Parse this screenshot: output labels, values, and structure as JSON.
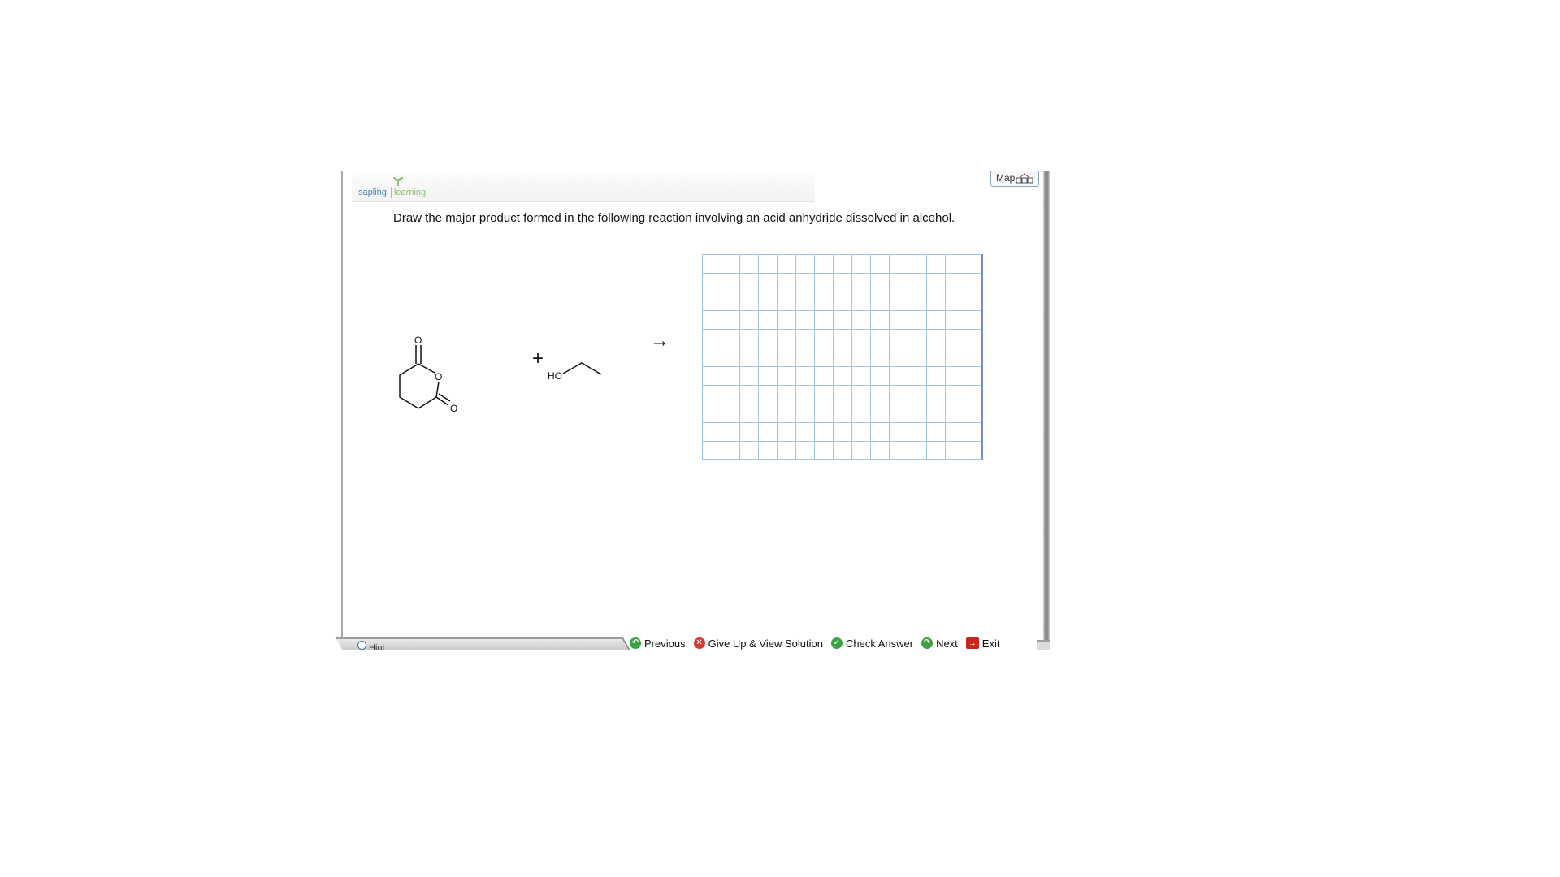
{
  "header": {
    "logo_word1": "sapling",
    "logo_word2": "learning",
    "map_label": "Map"
  },
  "question": {
    "text": "Draw the major product formed in the following reaction involving an acid anhydride dissolved in alcohol."
  },
  "reaction": {
    "plus": "+",
    "arrow": "→",
    "atom_labels": {
      "carbonyl_top_o": "O",
      "ring_o": "O",
      "carbonyl_bottom_o": "O",
      "alcohol_ho": "HO"
    }
  },
  "hint": {
    "label": "Hint"
  },
  "nav": {
    "previous": "Previous",
    "give_up": "Give Up & View Solution",
    "check": "Check Answer",
    "next": "Next",
    "exit": "Exit"
  },
  "colors": {
    "grid_line": "#9fc5ea",
    "logo_blue": "#4b86b4",
    "logo_green": "#8dc26b",
    "nav_green": "#3aa33f",
    "nav_red": "#d43a2f"
  }
}
